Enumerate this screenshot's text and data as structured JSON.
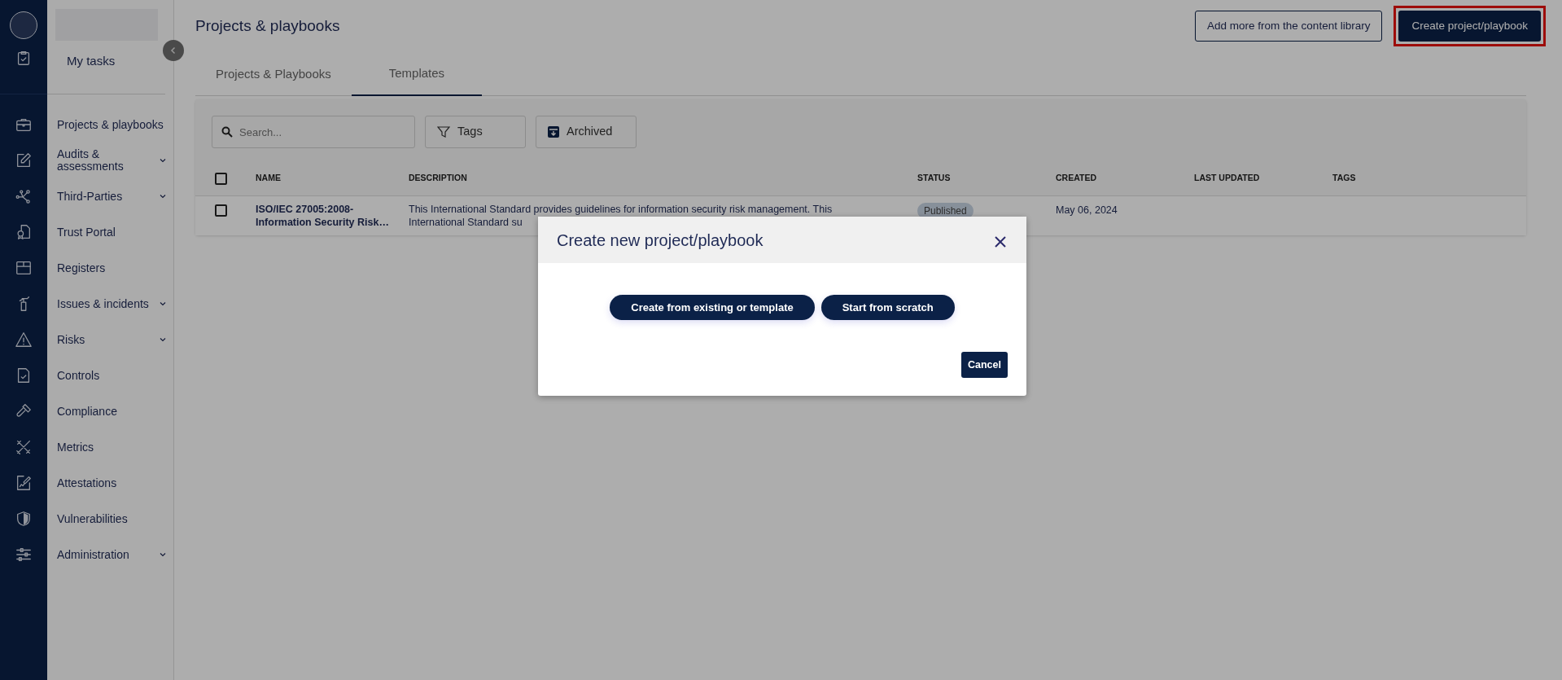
{
  "sidebar": {
    "top_item": {
      "label": "My tasks"
    },
    "items": [
      {
        "label": "Projects & playbooks",
        "expandable": false
      },
      {
        "label": "Audits & assessments",
        "expandable": true
      },
      {
        "label": "Third-Parties",
        "expandable": true
      },
      {
        "label": "Trust Portal",
        "expandable": false
      },
      {
        "label": "Registers",
        "expandable": false
      },
      {
        "label": "Issues & incidents",
        "expandable": true
      },
      {
        "label": "Risks",
        "expandable": true
      },
      {
        "label": "Controls",
        "expandable": false
      },
      {
        "label": "Compliance",
        "expandable": false
      },
      {
        "label": "Metrics",
        "expandable": false
      },
      {
        "label": "Attestations",
        "expandable": false
      },
      {
        "label": "Vulnerabilities",
        "expandable": false
      },
      {
        "label": "Administration",
        "expandable": true
      }
    ]
  },
  "page": {
    "title": "Projects & playbooks",
    "buttons": [
      {
        "label": "Add more from the content library",
        "kind": "outline",
        "highlighted": false
      },
      {
        "label": "Create project/playbook",
        "kind": "primary",
        "highlighted": true
      }
    ]
  },
  "tabs": [
    {
      "label": "Projects & Playbooks",
      "selected": false
    },
    {
      "label": "Templates",
      "selected": true
    }
  ],
  "filters": {
    "search": {
      "placeholder": "Search..."
    },
    "buttons": [
      {
        "label": "Tags",
        "kind": "filter"
      },
      {
        "label": "Archived",
        "kind": "archive"
      }
    ]
  },
  "table": {
    "header_checked": false,
    "columns": [
      "NAME",
      "DESCRIPTION",
      "STATUS",
      "CREATED",
      "LAST UPDATED",
      "TAGS"
    ],
    "rows": [
      {
        "checked": false,
        "name": "ISO/IEC 27005:2008-Information Security Risk…",
        "description": "This International Standard provides guidelines for information security risk management. This International Standard su",
        "status": "Published",
        "created": "May 06, 2024"
      }
    ]
  },
  "modal": {
    "title": "Create new project/playbook",
    "options": [
      "Create from existing or template",
      "Start from scratch"
    ],
    "cancel": "Cancel"
  }
}
